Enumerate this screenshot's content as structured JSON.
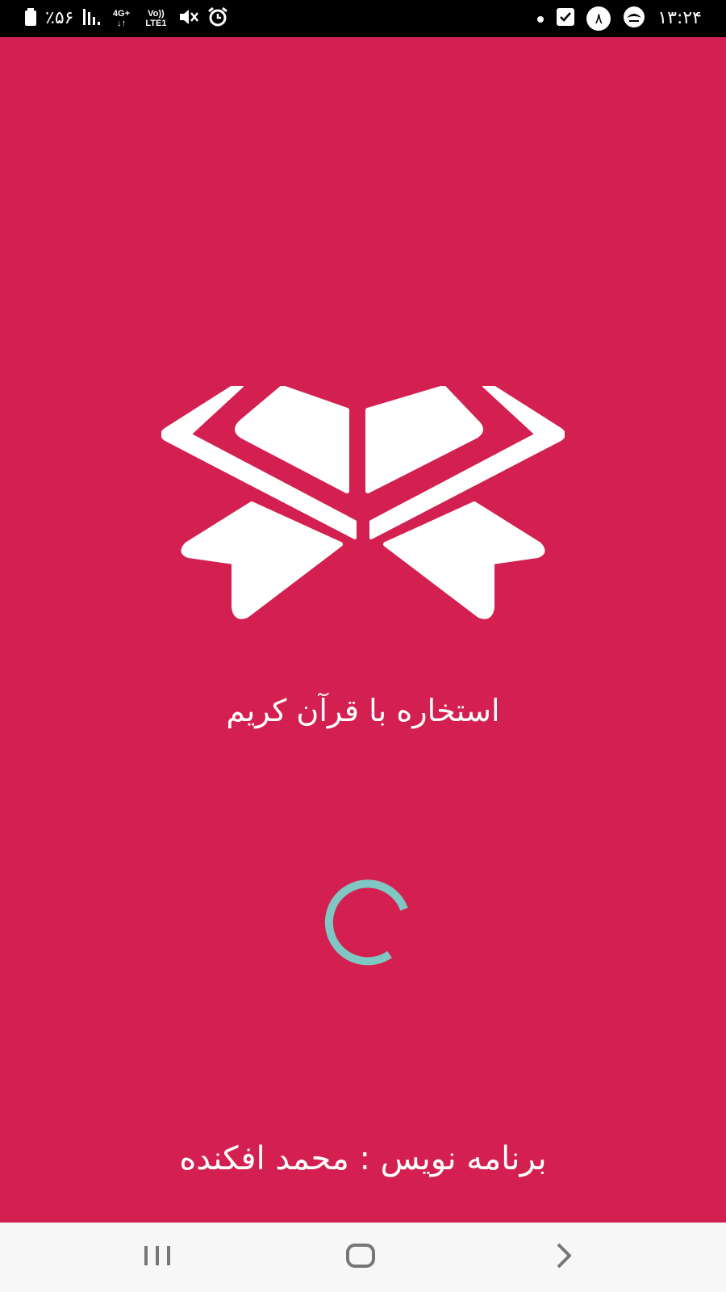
{
  "status_bar": {
    "battery": "٪۵۶",
    "network_top": "4G+",
    "network_volte": "Vo))",
    "network_lte": "LTE1",
    "notification_count": "۸",
    "time": "۱۳:۲۴",
    "icons": [
      "battery-icon",
      "signal-icon",
      "mute-icon",
      "alarm-icon",
      "dot-icon",
      "check-notification-icon",
      "badge-icon",
      "app-notification-icon"
    ]
  },
  "splash": {
    "logo_icon": "quran-book-icon",
    "title": "استخاره با قرآن کریم",
    "developer": "برنامه نویس : محمد افکنده",
    "spinner_icon": "loading-spinner-icon"
  },
  "nav_bar": {
    "icons": [
      "recents-icon",
      "home-icon",
      "back-icon"
    ]
  },
  "colors": {
    "background": "#d32050",
    "spinner": "#7fc7c3",
    "status_bar": "#000000",
    "nav_bar": "#f7f7f7",
    "nav_icons": "#777777"
  }
}
